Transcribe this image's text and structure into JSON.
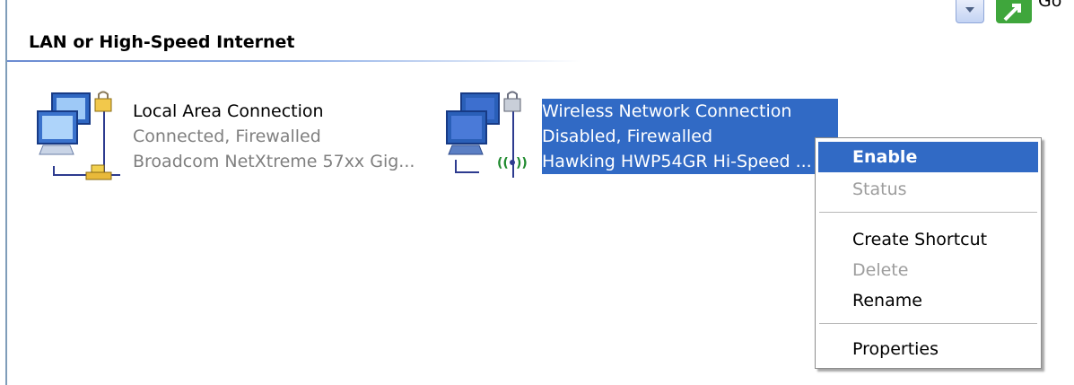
{
  "toolbar": {
    "go_label": "Go"
  },
  "group": {
    "header": "LAN or High-Speed Internet"
  },
  "connections": [
    {
      "name": "Local Area Connection",
      "status": "Connected, Firewalled",
      "device": "Broadcom NetXtreme 57xx Gig...",
      "icon": "network-computers-icon",
      "selected": false
    },
    {
      "name": "Wireless Network Connection",
      "status": "Disabled, Firewalled",
      "device": "Hawking HWP54GR Hi-Speed ...",
      "icon": "wireless-network-icon",
      "selected": true
    }
  ],
  "context_menu": {
    "items": [
      {
        "label": "Enable",
        "state": "highlighted"
      },
      {
        "label": "Status",
        "state": "disabled"
      },
      {
        "label": "Create Shortcut",
        "state": "normal"
      },
      {
        "label": "Delete",
        "state": "disabled"
      },
      {
        "label": "Rename",
        "state": "normal"
      },
      {
        "label": "Properties",
        "state": "normal"
      }
    ]
  },
  "colors": {
    "selection": "#316ac5",
    "disabled_text": "#9d9d9d",
    "header_rule": "#6b8bd1"
  }
}
